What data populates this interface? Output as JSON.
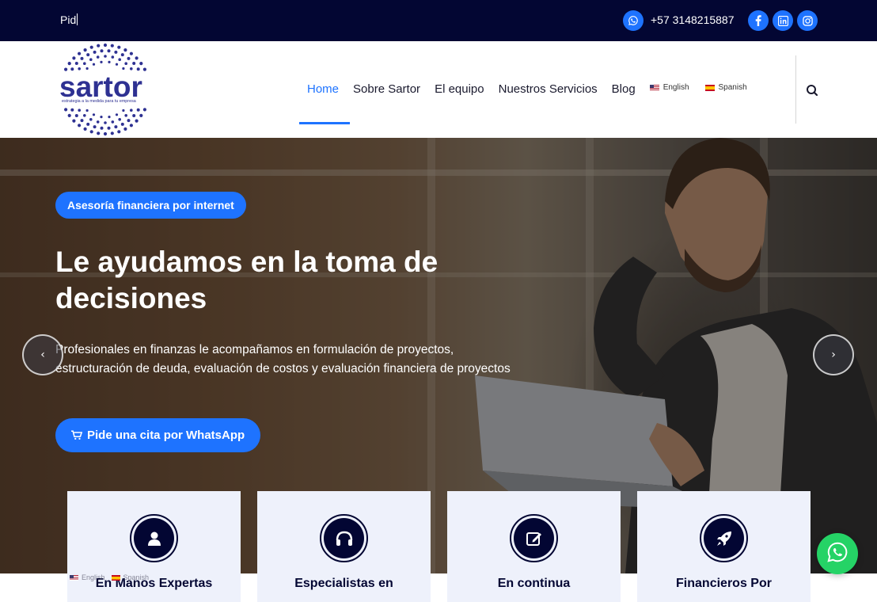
{
  "topbar": {
    "tagline": "Pid",
    "phone": "+57 3148215887",
    "social": [
      "whatsapp-icon",
      "facebook-icon",
      "linkedin-icon",
      "instagram-icon"
    ]
  },
  "header": {
    "logo_text": "sartor",
    "logo_tagline": "estrategia a la medida para tu empresa",
    "nav": [
      "Home",
      "Sobre Sartor",
      "El equipo",
      "Nuestros Servicios",
      "Blog"
    ],
    "active_nav": "Home",
    "languages": [
      "English",
      "Spanish"
    ]
  },
  "hero": {
    "badge": "Asesoría financiera por internet",
    "title": "Le ayudamos en la toma de decisiones",
    "description": "Profesionales en finanzas le acompañamos en formulación de proyectos, estructuración de deuda, evaluación de costos y evaluación financiera de proyectos",
    "cta": "Pide una cita por WhatsApp"
  },
  "features": [
    {
      "title": "En Manos Expertas",
      "icon": "user-icon"
    },
    {
      "title": "Especialistas en",
      "icon": "headset-icon"
    },
    {
      "title": "En continua",
      "icon": "edit-icon"
    },
    {
      "title": "Financieros Por",
      "icon": "rocket-icon"
    }
  ],
  "colors": {
    "navy": "#030633",
    "accent": "#1e73ff",
    "whatsapp": "#25d366"
  }
}
